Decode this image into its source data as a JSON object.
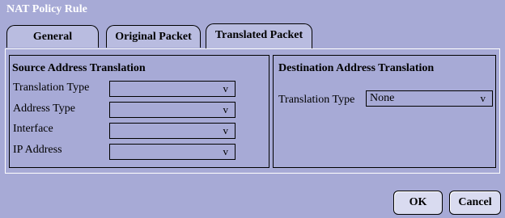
{
  "window": {
    "title": "NAT Policy Rule"
  },
  "tabs": [
    {
      "label": "General"
    },
    {
      "label": "Original Packet"
    },
    {
      "label": "Translated Packet"
    }
  ],
  "source": {
    "title": "Source Address Translation",
    "fields": [
      {
        "label": "Translation Type",
        "value": ""
      },
      {
        "label": "Address Type",
        "value": ""
      },
      {
        "label": "Interface",
        "value": ""
      },
      {
        "label": "IP Address",
        "value": ""
      }
    ]
  },
  "destination": {
    "title": "Destination Address Translation",
    "fields": [
      {
        "label": "Translation Type",
        "value": "None"
      }
    ]
  },
  "chevron": "v",
  "buttons": {
    "ok": "OK",
    "cancel": "Cancel"
  }
}
